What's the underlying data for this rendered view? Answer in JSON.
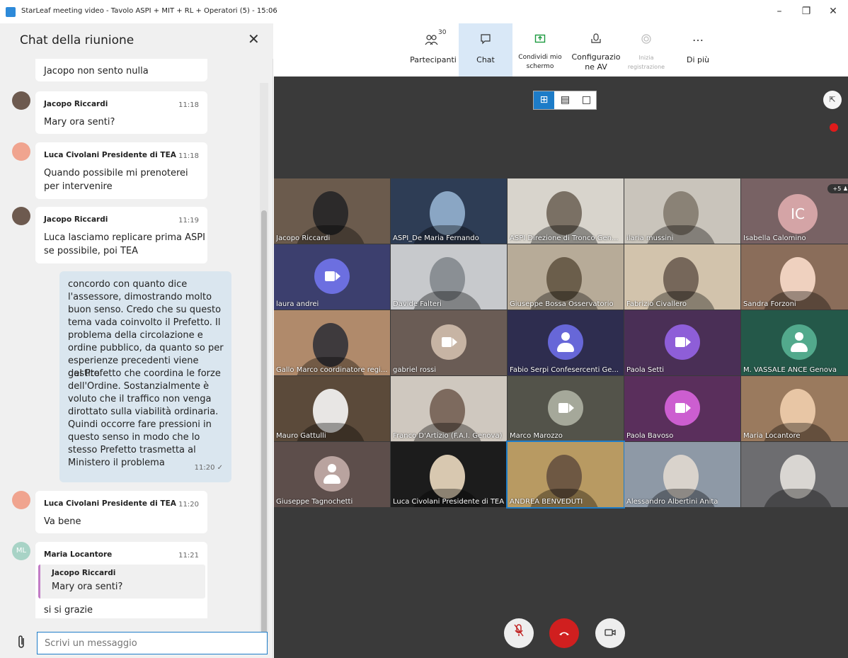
{
  "window": {
    "title": "StarLeaf meeting video - Tavolo ASPI + MIT + RL + Operatori (5) - 15:06",
    "minimize": "–",
    "restore": "❐",
    "close": "✕"
  },
  "chat": {
    "title": "Chat della riunione",
    "close_icon": "✕",
    "messages": [
      {
        "text": "Jacopo non sento nulla"
      },
      {
        "author": "Jacopo Riccardi",
        "time": "11:18",
        "text": "Mary ora senti?"
      },
      {
        "author": "Luca Civolani Presidente di TEA",
        "time": "11:18",
        "text_line1": "Quando possibile mi prenoterei",
        "text_line2": "per intervenire"
      },
      {
        "author": "Jacopo Riccardi",
        "time": "11:19",
        "text_line1": "Luca lasciamo replicare prima ASPI",
        "text_line2": "se possibile, poi TEA"
      },
      {
        "author": "Luca Civolani Presidente di TEA",
        "time": "11:20",
        "text": "Va bene"
      },
      {
        "author": "Maria Locantore",
        "initials": "ML",
        "time": "11:21",
        "quote_author": "Jacopo Riccardi",
        "quote_text": "Mary ora senti?",
        "text": "si si grazie"
      }
    ],
    "own_message": {
      "lines": [
        "concordo con quanto dice",
        "l'assessore, dimostrando molto",
        "buon senso. Credo che su questo",
        "tema vada coinvolto il Prefetto. Il",
        "problema della circolazione e",
        "ordine pubblico, da quanto so per",
        "esperienze precedenti viene gestito",
        "dal Prefetto che coordina le forze",
        "dell'Ordine. Sostanzialmente è",
        "voluto che il traffico non venga",
        "dirottato sulla viabilità ordinaria.",
        "Quindi occorre fare pressioni in",
        "questo senso in modo che lo",
        "stesso Prefetto trasmetta al",
        "Ministero il problema"
      ],
      "time": "11:20 ✓"
    },
    "input_placeholder": "Scrivi un messaggio"
  },
  "toolbar": {
    "participants_label": "Partecipanti",
    "participants_count": "30",
    "chat_label": "Chat",
    "share_line1": "Condividi mio",
    "share_line2": "schermo",
    "av_line1": "Configurazio",
    "av_line2": "ne AV",
    "record_line1": "Inizia",
    "record_line2": "registrazione",
    "more_icon": "…",
    "more_label": "Di più"
  },
  "video": {
    "more_badge": "+5 ♟",
    "ic_initials": "IC",
    "tiles": [
      "Jacopo Riccardi",
      "ASPI_De Maria Fernando",
      "ASPI Direzione di Tronco Gen...",
      "ilaria mussini",
      "Isabella Calomino",
      "laura andrei",
      "Davide Falteri",
      "Giuseppe Bossa Osservatorio",
      "Fabrizio Civallero",
      "Sandra Forzoni",
      "Gallo Marco coordinatore regi...",
      "gabriel rossi",
      "Fabio Serpi Confesercenti Ge...",
      "Paola Setti",
      "M. VASSALE ANCE Genova",
      "Mauro Gattulli",
      "Franco D'Artizio (F.A.I. Genova)",
      "Marco Marozzo",
      "Paola Bavoso",
      "Maria Locantore",
      "Giuseppe Tagnochetti",
      "Luca Civolani Presidente di TEA",
      "ANDREA BENVEDUTI",
      "Alessandro Albertini Anita",
      ""
    ]
  },
  "colors": {
    "accent": "#1d7cc8",
    "hangup": "#d01f1f",
    "video_bg": "#3a3a3a",
    "own_bubble": "#dae6ef"
  }
}
